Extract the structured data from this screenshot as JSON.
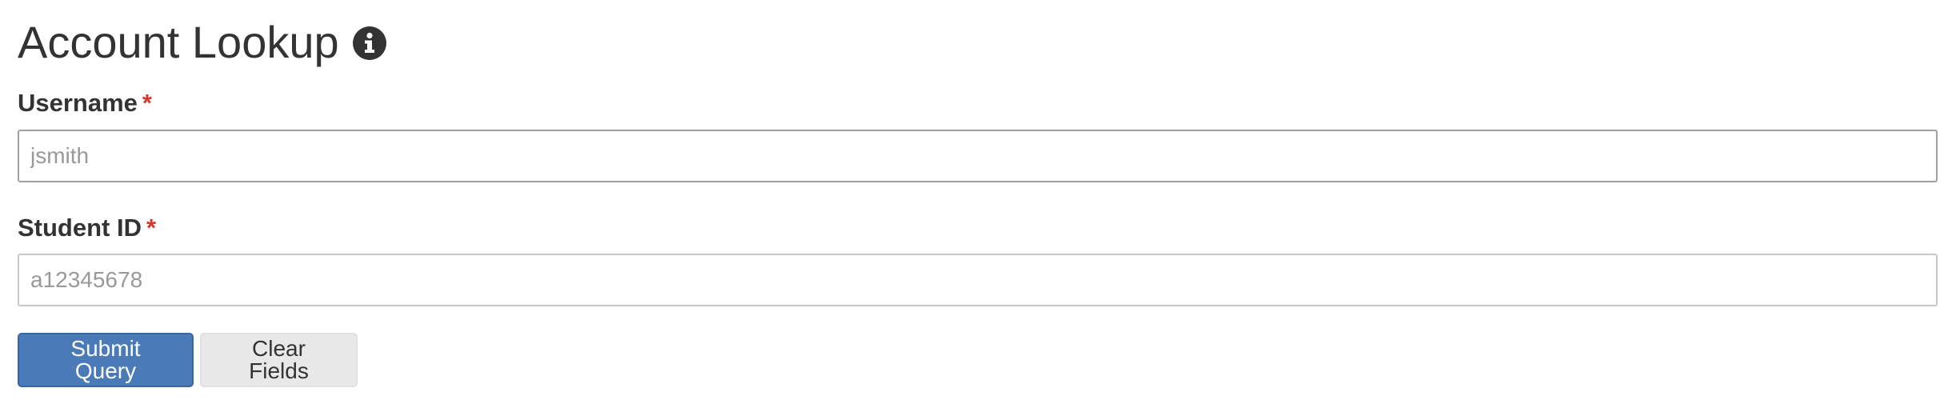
{
  "header": {
    "title": "Account Lookup",
    "info_icon": "info-circle-icon"
  },
  "form": {
    "username": {
      "label": "Username",
      "required_marker": "*",
      "value": "",
      "placeholder": "jsmith"
    },
    "student_id": {
      "label": "Student ID",
      "required_marker": "*",
      "value": "",
      "placeholder": "a12345678"
    },
    "buttons": {
      "submit_label": "Submit Query",
      "clear_label": "Clear Fields"
    }
  },
  "colors": {
    "primary_button": "#4a7ab7",
    "secondary_button": "#e8e8e8",
    "required_star": "#d9352a",
    "text": "#333333"
  }
}
